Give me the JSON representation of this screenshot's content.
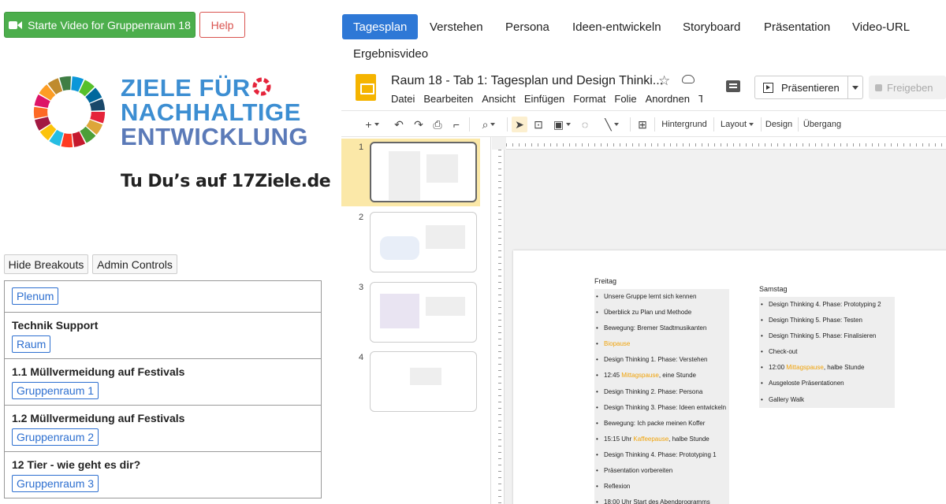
{
  "left": {
    "video_button": "Starte Video for Gruppenraum 18",
    "help_button": "Help",
    "logo": {
      "line1": "ZIELE FÜR",
      "line2": "NACHHALTIGE",
      "line3": "ENTWICKLUNG",
      "tagline": "Tu Du’s auf 17Ziele.de"
    },
    "hide_breakouts": "Hide Breakouts",
    "admin_controls": "Admin Controls",
    "rooms": [
      {
        "title": "",
        "button": "Plenum"
      },
      {
        "title": "Technik Support",
        "button": "Raum"
      },
      {
        "title": "1.1 Müllvermeidung auf Festivals",
        "button": "Gruppenraum 1"
      },
      {
        "title": "1.2 Müllvermeidung auf Festivals",
        "button": "Gruppenraum 2"
      },
      {
        "title": "12 Tier - wie geht es dir?",
        "button": "Gruppenraum 3"
      }
    ]
  },
  "tabs": {
    "active": "Tagesplan",
    "t1": "Tagesplan",
    "t2": "Verstehen",
    "t3": "Persona",
    "t4": "Ideen-entwickeln",
    "t5": "Storyboard",
    "t6": "Präsentation",
    "t7": "Video-URL",
    "t8": "Ergebnisvideo"
  },
  "slides_app": {
    "doc_title": "Raum 18 - Tab 1: Tagesplan und Design Thinki...",
    "menus": [
      "Datei",
      "Bearbeiten",
      "Ansicht",
      "Einfügen",
      "Format",
      "Folie",
      "Anordnen",
      "To"
    ],
    "present_button": "Präsentieren",
    "share_button": "Freigeben",
    "toolbar": {
      "background": "Hintergrund",
      "layout": "Layout",
      "design": "Design",
      "transition": "Übergang"
    },
    "slide_numbers": [
      "1",
      "2",
      "3",
      "4"
    ],
    "slide": {
      "col1_title": "Freitag",
      "col1_items": [
        {
          "pre": "Unsere Gruppe lernt sich kennen",
          "hl": "",
          "post": ""
        },
        {
          "pre": "Überblick zu Plan und Methode",
          "hl": "",
          "post": ""
        },
        {
          "pre": "Bewegung: Bremer Stadtmusikanten",
          "hl": "",
          "post": ""
        },
        {
          "pre": "",
          "hl": "Biopause",
          "post": ""
        },
        {
          "pre": "Design Thinking 1. Phase: Verstehen",
          "hl": "",
          "post": ""
        },
        {
          "pre": "12:45 ",
          "hl": "Mittagspause",
          "post": ", eine Stunde"
        },
        {
          "pre": "Design Thinking 2. Phase: Persona",
          "hl": "",
          "post": ""
        },
        {
          "pre": "Design Thinking 3. Phase: Ideen entwickeln",
          "hl": "",
          "post": ""
        },
        {
          "pre": "Bewegung: Ich packe meinen Koffer",
          "hl": "",
          "post": ""
        },
        {
          "pre": "15:15 Uhr ",
          "hl": "Kaffeepause",
          "post": ", halbe Stunde"
        },
        {
          "pre": "Design Thinking 4. Phase: Prototyping 1",
          "hl": "",
          "post": ""
        },
        {
          "pre": "Präsentation vorbereiten",
          "hl": "",
          "post": ""
        },
        {
          "pre": "Reflexion",
          "hl": "",
          "post": ""
        },
        {
          "pre": "18:00 Uhr Start des Abendprogramms",
          "hl": "",
          "post": ""
        }
      ],
      "col2_title": "Samstag",
      "col2_items": [
        {
          "pre": "Design Thinking 4. Phase: Prototyping 2",
          "hl": "",
          "post": ""
        },
        {
          "pre": "Design Thinking 5. Phase: Testen",
          "hl": "",
          "post": ""
        },
        {
          "pre": "Design Thinking 5. Phase: Finalisieren",
          "hl": "",
          "post": ""
        },
        {
          "pre": "Check-out",
          "hl": "",
          "post": ""
        },
        {
          "pre": "12:00 ",
          "hl": "Mittagspause",
          "post": ", halbe Stunde"
        },
        {
          "pre": "Ausgeloste Präsentationen",
          "hl": "",
          "post": ""
        },
        {
          "pre": "Gallery Walk",
          "hl": "",
          "post": ""
        }
      ]
    }
  },
  "colors": {
    "video_green": "#4cae4c",
    "help_red": "#d9534f",
    "tab_active": "#2e78d6",
    "room_link": "#2d6fd0",
    "slides_yellow": "#f5b400",
    "highlight_orange": "#f0a30a"
  }
}
